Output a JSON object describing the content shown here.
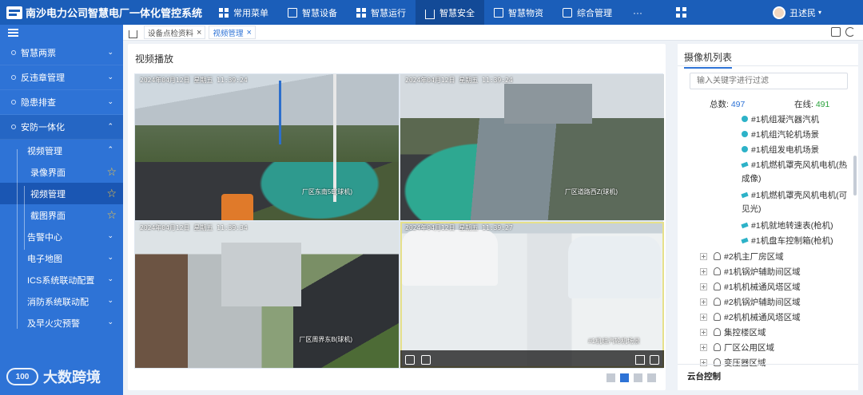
{
  "app": {
    "title": "南沙电力公司智慧电厂一体化管控系统"
  },
  "nav": {
    "items": [
      {
        "label": "常用菜单",
        "icon": "grid-icon"
      },
      {
        "label": "智慧设备",
        "icon": "doc-icon"
      },
      {
        "label": "智慧运行",
        "icon": "grid-icon"
      },
      {
        "label": "智慧安全",
        "icon": "house-icon",
        "active": true
      },
      {
        "label": "智慧物资",
        "icon": "doc-icon"
      },
      {
        "label": "综合管理",
        "icon": "copy-icon"
      }
    ],
    "more": "···"
  },
  "user": {
    "name": "丑述民"
  },
  "sidebar": {
    "items": [
      {
        "label": "智慧两票"
      },
      {
        "label": "反违章管理"
      },
      {
        "label": "隐患排查"
      },
      {
        "label": "安防一体化"
      }
    ],
    "sub": {
      "video_mgmt": "视频管理",
      "record": "录像界面",
      "video": "视频管理",
      "capture": "截图界面"
    },
    "more_items": [
      {
        "label": "告警中心"
      },
      {
        "label": "电子地图"
      },
      {
        "label": "ICS系统联动配置"
      },
      {
        "label": "消防系统联动配"
      },
      {
        "label": "及早火灾预警"
      }
    ]
  },
  "watermark": {
    "brand": "大数跨境"
  },
  "tabs": [
    {
      "label": "设备点检资料"
    },
    {
      "label": "视频管理",
      "active": true
    }
  ],
  "video": {
    "title": "视频播放",
    "cameras": [
      {
        "timestamp": "2024年04月12日 星期五 11:39:24",
        "label": "厂区东南5E(球机)"
      },
      {
        "timestamp": "2024年04月12日 星期五 11:39:24",
        "label": "厂区道路西Z(球机)"
      },
      {
        "timestamp": "2024年04月12日 星期五 11:39:34",
        "label": "厂区周界东B(球机)"
      },
      {
        "timestamp": "2024年04月12日 星期五 11:39:27",
        "label": "#1机组汽轮机场景"
      }
    ]
  },
  "camera_list": {
    "title": "摄像机列表",
    "search_placeholder": "输入关键字进行过滤",
    "total_label": "总数:",
    "total": "497",
    "online_label": "在线:",
    "online": "491",
    "tree": {
      "cam1": "#1机组凝汽器汽机",
      "cam2": "#1机组汽轮机场景",
      "cam3": "#1机组发电机场景",
      "cam4a": "#1机燃机罩壳风机电机(热",
      "cam4b": "成像)",
      "cam5a": "#1机燃机罩壳风机电机(可",
      "cam5b": "见光)",
      "cam6": "#1机就地转速表(枪机)",
      "cam7": "#1机盘车控制箱(枪机)",
      "area1": "#2机主厂房区域",
      "area2": "#1机锅炉辅助间区域",
      "area3": "#1机机械通风塔区域",
      "area4": "#2机锅炉辅助间区域",
      "area5": "#2机机械通风塔区域",
      "area6": "集控楼区域",
      "area7": "厂区公用区域",
      "area8": "变压器区域"
    },
    "ptz": "云台控制"
  }
}
